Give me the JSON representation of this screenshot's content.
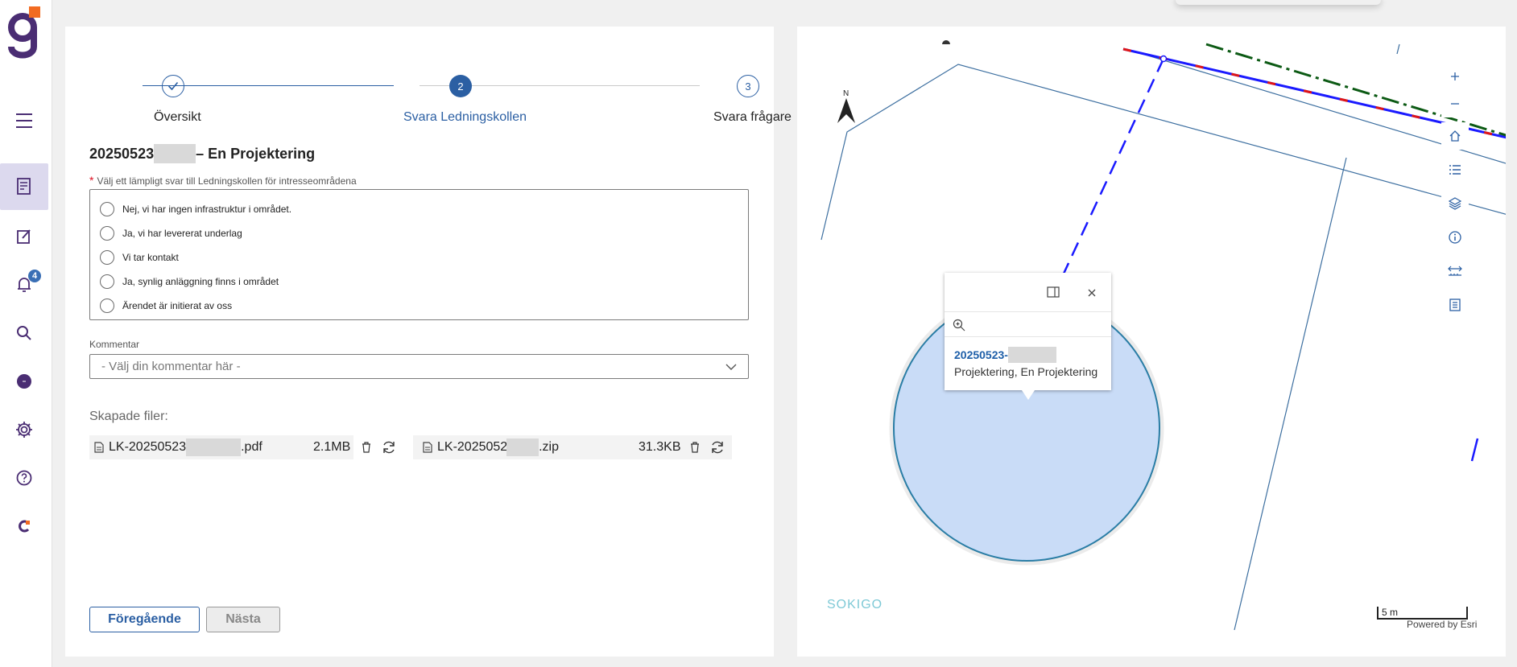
{
  "sidebar": {
    "badge_count": "4",
    "items": [
      {
        "name": "menu",
        "icon": "hamburger-icon"
      },
      {
        "name": "cases",
        "icon": "document-icon",
        "active": true
      },
      {
        "name": "edit",
        "icon": "edit-icon"
      },
      {
        "name": "notifications",
        "icon": "bell-icon"
      },
      {
        "name": "search",
        "icon": "search-icon"
      },
      {
        "name": "status",
        "icon": "circle-icon"
      },
      {
        "name": "settings",
        "icon": "gear-icon"
      },
      {
        "name": "help",
        "icon": "help-icon"
      },
      {
        "name": "brand",
        "icon": "brand-icon"
      }
    ]
  },
  "stepper": {
    "steps": [
      {
        "number": "",
        "label": "Översikt",
        "state": "done"
      },
      {
        "number": "2",
        "label": "Svara Ledningskollen",
        "state": "active"
      },
      {
        "number": "3",
        "label": "Svara frågare",
        "state": "pending"
      }
    ]
  },
  "form": {
    "title_prefix": "20250523",
    "title_suffix": "– En Projektering",
    "question_label": "Välj ett lämpligt svar till Ledningskollen för intresseområdena",
    "options": [
      "Nej, vi har ingen infrastruktur i området.",
      "Ja, vi har levererat underlag",
      "Vi tar kontakt",
      "Ja, synlig anläggning finns i området",
      "Ärendet är initierat av oss"
    ],
    "comment_label": "Kommentar",
    "comment_placeholder": "- Välj din kommentar här -",
    "files_label": "Skapade filer:",
    "files": [
      {
        "prefix": "LK-20250523",
        "ext": ".pdf",
        "size": "2.1MB"
      },
      {
        "prefix": "LK-20250523",
        "ext": ".zip",
        "size": "31.3KB"
      }
    ],
    "prev_button": "Föregående",
    "next_button": "Nästa"
  },
  "map": {
    "north_label": "N",
    "popup": {
      "title": "20250523-",
      "subtitle": "Projektering, En Projektering"
    },
    "brand": "SOKIGO",
    "scale_label": "5 m",
    "attribution": "Powered by Esri",
    "tools": [
      "zoom-in",
      "zoom-out",
      "home",
      "legend",
      "layers",
      "info",
      "measure",
      "print"
    ]
  },
  "colors": {
    "primary": "#2b5fa3",
    "active_nav": "#dcd9ee",
    "brand_purple": "#4a2d73",
    "brand_orange": "#f26b21",
    "map_line": "#3d6fa0",
    "buffer_fill": "#c9dcf7"
  }
}
